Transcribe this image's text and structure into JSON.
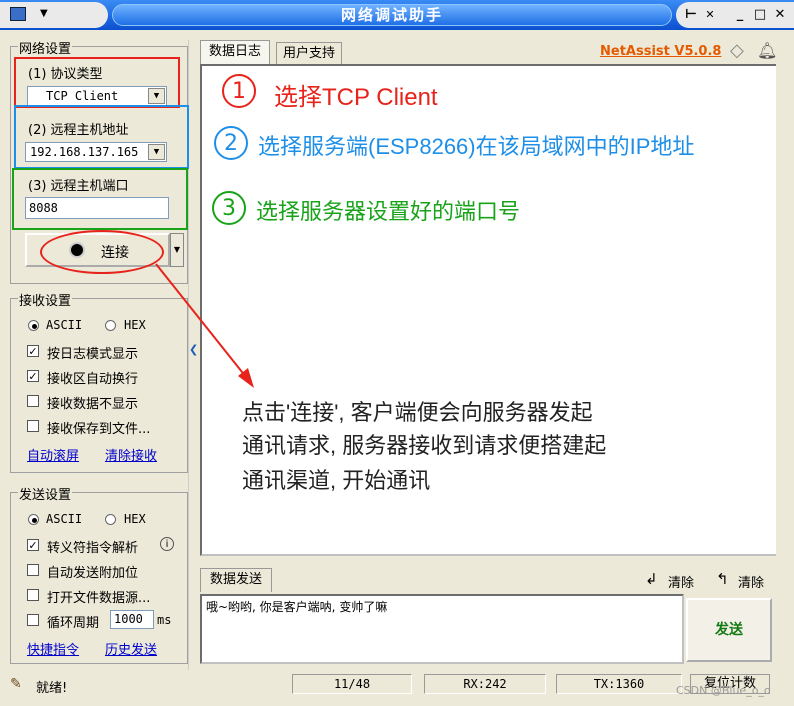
{
  "window": {
    "title": "网络调试助手",
    "controls": [
      "◻",
      "_",
      "□",
      "×"
    ]
  },
  "network_settings": {
    "group_label": "网络设置",
    "protocol": {
      "label": "(1) 协议类型",
      "value": "TCP Client"
    },
    "remote_host": {
      "label": "(2) 远程主机地址",
      "value": "192.168.137.165"
    },
    "remote_port": {
      "label": "(3) 远程主机端口",
      "value": "8088"
    },
    "connect_label": "连接"
  },
  "receive_settings": {
    "group_label": "接收设置",
    "mode_ascii": "ASCII",
    "mode_hex": "HEX",
    "options": [
      {
        "label": "按日志模式显示",
        "checked": true
      },
      {
        "label": "接收区自动换行",
        "checked": true
      },
      {
        "label": "接收数据不显示",
        "checked": false
      },
      {
        "label": "接收保存到文件...",
        "checked": false
      }
    ],
    "link_autoscroll": "自动滚屏",
    "link_clear": "清除接收"
  },
  "send_settings": {
    "group_label": "发送设置",
    "mode_ascii": "ASCII",
    "mode_hex": "HEX",
    "options": [
      {
        "label": "转义符指令解析",
        "checked": true
      },
      {
        "label": "自动发送附加位",
        "checked": false
      },
      {
        "label": "打开文件数据源...",
        "checked": false
      },
      {
        "label": "循环周期",
        "checked": false
      }
    ],
    "cycle_value": "1000",
    "cycle_unit": "ms",
    "link_shortcuts": "快捷指令",
    "link_history": "历史发送"
  },
  "tabs": {
    "log": "数据日志",
    "users": "用户支持"
  },
  "brand": "NetAssist V5.0.8",
  "send_area": {
    "tab_label": "数据发送",
    "clear1": "清除",
    "clear2": "清除",
    "text": "哦~哟哟, 你是客户端呐, 变帅了嘛",
    "send_button": "发送"
  },
  "status": {
    "ready": "就绪!",
    "count": "11/48",
    "rx": "RX:242",
    "tx": "TX:1360",
    "reset": "复位计数"
  },
  "annotations": {
    "step1_num": "1",
    "step1": "选择TCP Client",
    "step2_num": "2",
    "step2": "选择服务端(ESP8266)在该局域网中的IP地址",
    "step3_num": "3",
    "step3": "选择服务器设置好的端口号",
    "note_line1": "点击'连接', 客户端便会向服务器发起",
    "note_line2": "通讯请求, 服务器接收到请求便搭建起",
    "note_line3": "通讯渠道, 开始通讯",
    "colors": {
      "red": "#e8231b",
      "blue": "#1e8fe8",
      "green": "#19a319"
    }
  },
  "watermark": "CSDN @Blue_o_o"
}
